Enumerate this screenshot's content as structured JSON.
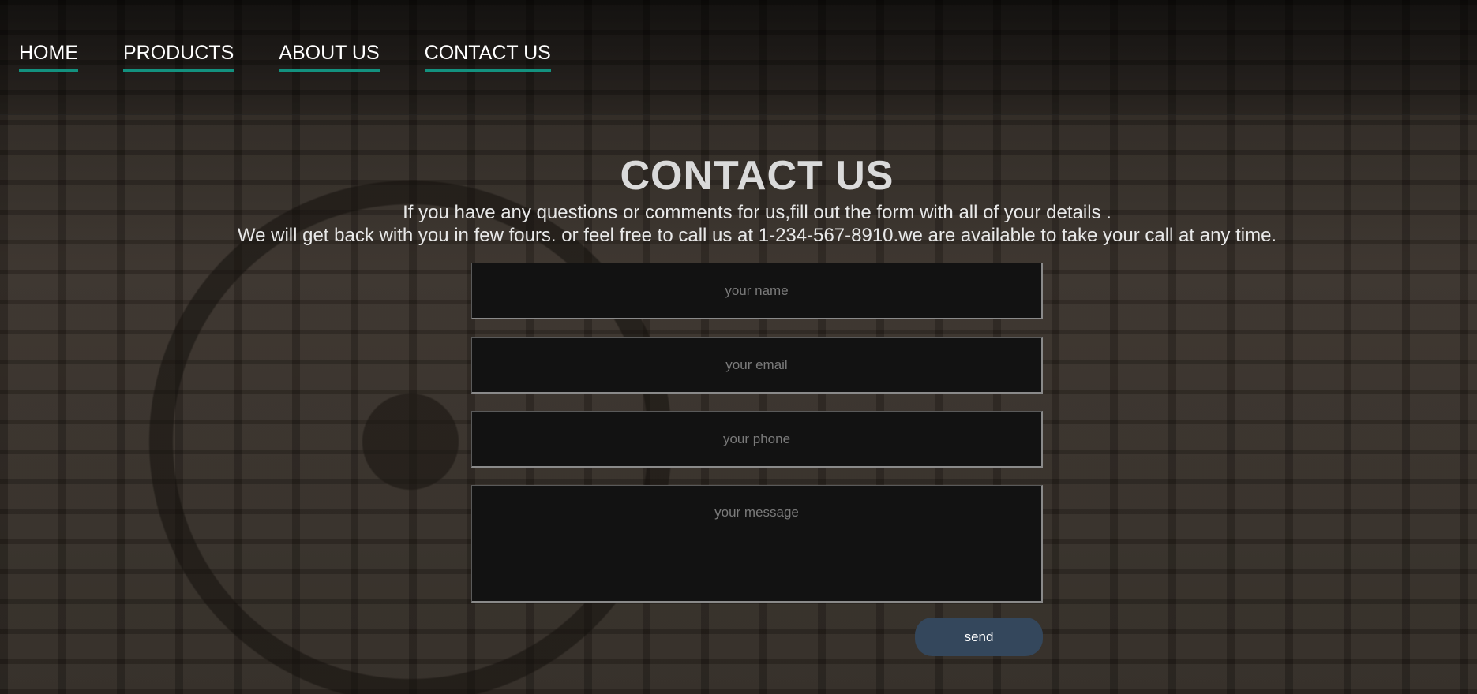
{
  "nav": {
    "items": [
      {
        "label": "HOME"
      },
      {
        "label": "PRODUCTS"
      },
      {
        "label": "ABOUT US"
      },
      {
        "label": "CONTACT US"
      }
    ],
    "underline_color": "#13917f"
  },
  "contact": {
    "title": "CONTACT US",
    "line1": "If you have any questions or comments for us,fill out the form with all of your details .",
    "line2": "We will get back with you in few fours. or feel free to call us at 1-234-567-8910.we are available to take your call at any time."
  },
  "form": {
    "name_placeholder": "your name",
    "email_placeholder": "your email",
    "phone_placeholder": "your phone",
    "message_placeholder": "your message",
    "send_label": "send",
    "button_color": "#34475c"
  }
}
